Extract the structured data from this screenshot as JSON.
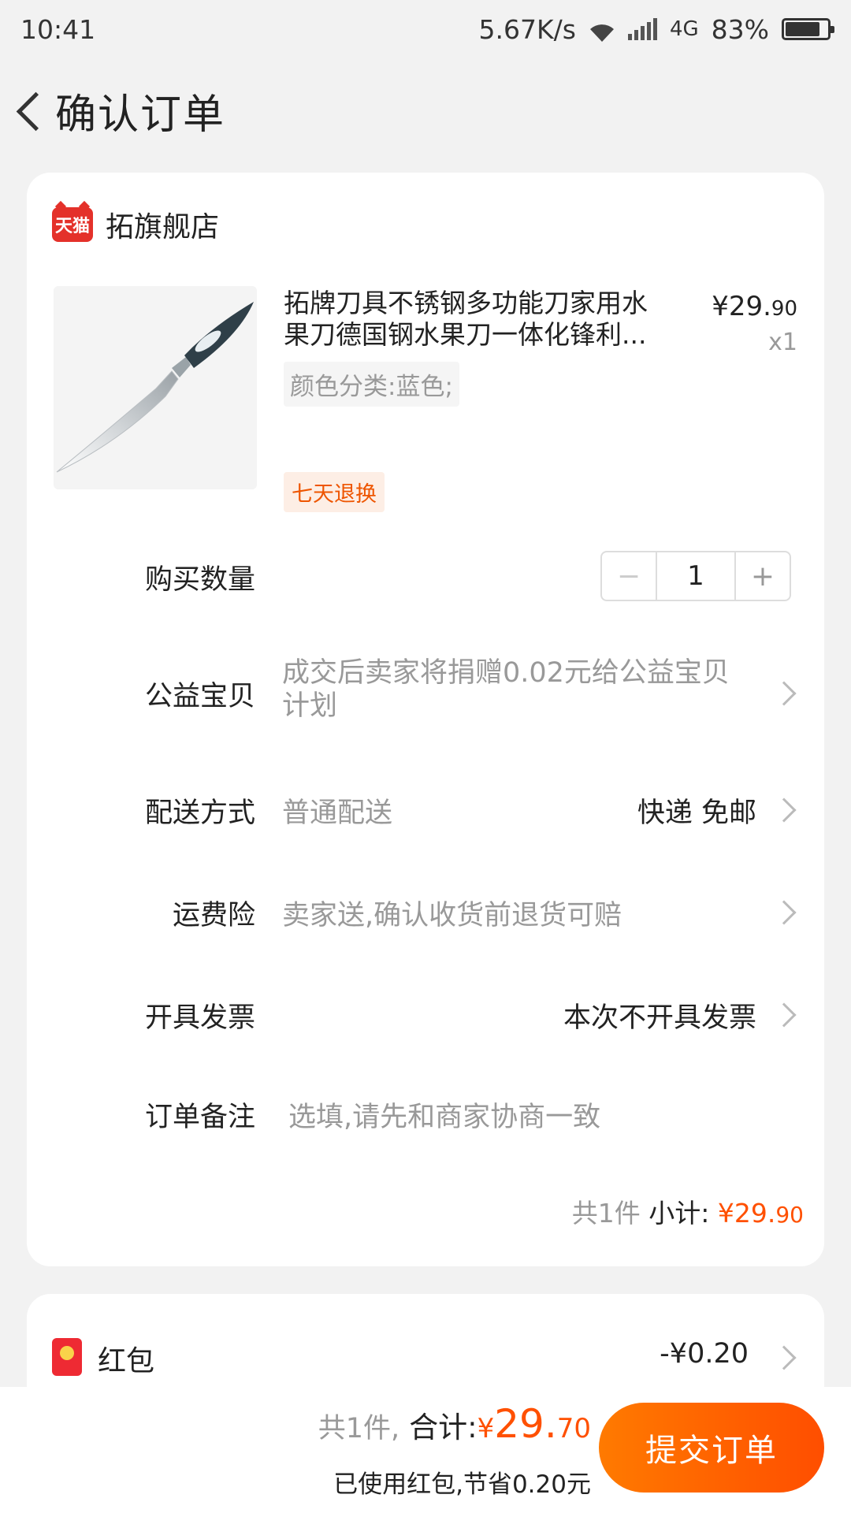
{
  "status_bar": {
    "time": "10:41",
    "speed": "5.67K/s",
    "network": "4G",
    "battery": "83%",
    "battery_level": 0.83
  },
  "header": {
    "title": "确认订单"
  },
  "shop": {
    "badge": "天猫",
    "name": "拓旗舰店"
  },
  "product": {
    "title": "拓牌刀具不锈钢多功能刀家用水果刀德国钢水果刀一体化锋利...",
    "sku": "颜色分类:蓝色;",
    "price_main": "¥29.",
    "price_decimal": "90",
    "quantity_text": "x1",
    "tag": "七天退换"
  },
  "rows": {
    "quantity": {
      "label": "购买数量",
      "minus": "−",
      "value": "1",
      "plus": "+"
    },
    "charity": {
      "label": "公益宝贝",
      "value": "成交后卖家将捐赠0.02元给公益宝贝计划"
    },
    "delivery": {
      "label": "配送方式",
      "value": "普通配送",
      "right": "快递 免邮"
    },
    "insurance": {
      "label": "运费险",
      "value": "卖家送,确认收货前退货可赔"
    },
    "invoice": {
      "label": "开具发票",
      "right": "本次不开具发票"
    },
    "note": {
      "label": "订单备注",
      "placeholder": "选填,请先和商家协商一致"
    }
  },
  "subtotal": {
    "count": "共1件 ",
    "label": "小计: ",
    "amount_main": "¥29.",
    "amount_decimal": "90"
  },
  "hongbao": {
    "label": "红包",
    "value": "-¥0.20"
  },
  "bottom": {
    "count": "共1件,",
    "label": "合计:",
    "symbol": "¥",
    "amount_main": "29.",
    "amount_decimal": "70",
    "saving": "已使用红包,节省0.20元",
    "submit": "提交订单"
  },
  "colors": {
    "accent": "#ff5000",
    "tmall_red": "#e4312a"
  }
}
